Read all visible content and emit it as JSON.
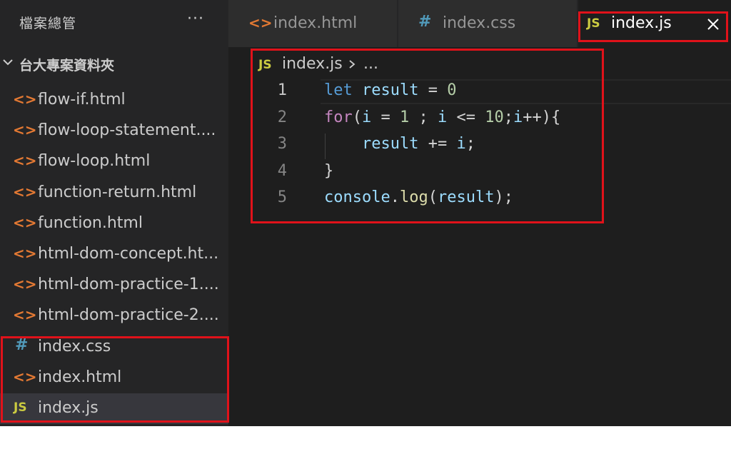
{
  "sidebar": {
    "title": "檔案總管",
    "more_icon": "···",
    "folder_name": "台大專案資料夾",
    "files": [
      {
        "name": "flow-if.html",
        "type": "html"
      },
      {
        "name": "flow-loop-statement....",
        "type": "html"
      },
      {
        "name": "flow-loop.html",
        "type": "html"
      },
      {
        "name": "function-return.html",
        "type": "html"
      },
      {
        "name": "function.html",
        "type": "html"
      },
      {
        "name": "html-dom-concept.ht...",
        "type": "html"
      },
      {
        "name": "html-dom-practice-1....",
        "type": "html"
      },
      {
        "name": "html-dom-practice-2....",
        "type": "html"
      },
      {
        "name": "index.css",
        "type": "css"
      },
      {
        "name": "index.html",
        "type": "html"
      },
      {
        "name": "index.js",
        "type": "js",
        "selected": true
      }
    ],
    "icon_glyphs": {
      "html": "<>",
      "css": "#",
      "js": "JS"
    }
  },
  "tabs": [
    {
      "label": "index.html",
      "icon": "<>",
      "active": false
    },
    {
      "label": "index.css",
      "icon": "#",
      "active": false
    },
    {
      "label": "index.js",
      "icon": "JS",
      "active": true
    }
  ],
  "breadcrumb": {
    "icon": "JS",
    "file": "index.js",
    "more": "..."
  },
  "editor": {
    "line_numbers": [
      "1",
      "2",
      "3",
      "4",
      "5"
    ],
    "lines": [
      "let result = 0",
      "for(i = 1 ; i <= 10;i++){",
      "    result += i;",
      "}",
      "console.log(result);"
    ]
  },
  "colors": {
    "annotation": "#e0121a",
    "html_icon": "#e37933",
    "css_icon": "#519aba",
    "js_icon": "#cbcb41"
  }
}
